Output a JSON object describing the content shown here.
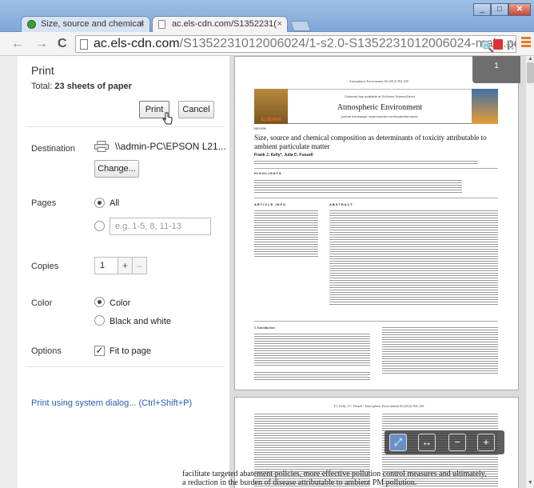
{
  "window": {
    "tabs": [
      {
        "title": "Size, source and chemical",
        "close": "×"
      },
      {
        "title": "ac.els-cdn.com/S1352231(",
        "close": "×"
      }
    ],
    "controls": {
      "minimize": "_",
      "maximize": "□",
      "close": "✕"
    }
  },
  "toolbar": {
    "back": "←",
    "forward": "→",
    "reload": "C",
    "url_host": "ac.els-cdn.com",
    "url_path": "/S1352231012006024/1-s2.0-S1352231012006024-main.pdf",
    "zoom_icon": "🔍",
    "star_icon": "☆"
  },
  "print": {
    "title": "Print",
    "total_prefix": "Total:",
    "total_value": "23 sheets of paper",
    "print_button": "Print",
    "cancel_button": "Cancel",
    "destination_label": "Destination",
    "destination_value": "\\\\admin-PC\\EPSON L21...",
    "change_button": "Change...",
    "pages_label": "Pages",
    "pages_all": "All",
    "pages_placeholder": "e.g. 1-5, 8, 11-13",
    "copies_label": "Copies",
    "copies_value": "1",
    "copies_plus": "+",
    "copies_minus": "–",
    "color_label": "Color",
    "color_option": "Color",
    "bw_option": "Black and white",
    "options_label": "Options",
    "fit_to_page": "Fit to page",
    "system_dialog_link": "Print using system dialog... (Ctrl+Shift+P)"
  },
  "preview": {
    "page_badge": "1",
    "journal_ref": "Atmospheric Environment 60 (2012) 504–526",
    "contents_line": "Contents lists available at SciVerse ScienceDirect",
    "journal_name": "Atmospheric Environment",
    "journal_url": "journal homepage: www.elsevier.com/locate/atmosenv",
    "publisher": "ELSEVIER",
    "section": "Review",
    "article_title": "Size, source and chemical composition as determinants of toxicity attributable to ambient particulate matter",
    "authors": "Frank J. Kelly*, Julia C. Fussell",
    "highlights_heading": "HIGHLIGHTS",
    "article_info_heading": "ARTICLE INFO",
    "abstract_heading": "ABSTRACT",
    "intro_heading": "1. Introduction",
    "page2_ref": "F.J. Kelly, J.C. Fussell / Atmospheric Environment 60 (2012) 504–526",
    "bottom_line1": "facilitate targeted abatement policies, more effective pollution control measures and ultimately,",
    "bottom_line2": "a reduction in the burden of disease attributable to ambient PM pollution."
  },
  "zoombar": {
    "fit": "⤢",
    "width": "↔",
    "zoom_out": "−",
    "zoom_in": "+"
  }
}
